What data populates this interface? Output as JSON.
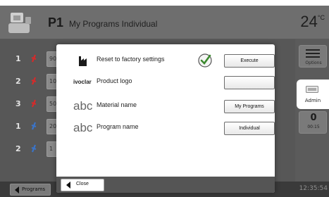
{
  "header": {
    "program_no": "P1",
    "title": "My Programs Individual",
    "temperature": "24",
    "temperature_unit": "°C"
  },
  "program_list": [
    {
      "num": "1",
      "status": "red",
      "value": "90"
    },
    {
      "num": "2",
      "status": "red",
      "value": "10"
    },
    {
      "num": "3",
      "status": "red",
      "value": "50"
    },
    {
      "num": "1",
      "status": "blue",
      "value": "20"
    },
    {
      "num": "2",
      "status": "blue",
      "value": "1"
    }
  ],
  "side_panel": {
    "options_label": "Options",
    "admin_label": "Admin",
    "timer_big": "0",
    "timer_small": "00:15"
  },
  "footer": {
    "programs_label": "Programs",
    "clock": "12:35:54"
  },
  "modal": {
    "rows": [
      {
        "icon": "factory-icon",
        "label": "Reset to factory settings",
        "button": "Execute",
        "has_check": true
      },
      {
        "icon": "ivoclar-logo",
        "label": "Product logo",
        "button": "",
        "logo_text": "ivoclar"
      },
      {
        "icon": "abc-icon",
        "label": "Material name",
        "button": "My Programs",
        "abc": "abc"
      },
      {
        "icon": "abc-icon",
        "label": "Program name",
        "button": "Individual",
        "abc": "abc"
      }
    ],
    "close_label": "Close"
  },
  "colors": {
    "status_red": "#d62a2a",
    "status_blue": "#3a74c9",
    "check_green": "#3c8a2e"
  }
}
